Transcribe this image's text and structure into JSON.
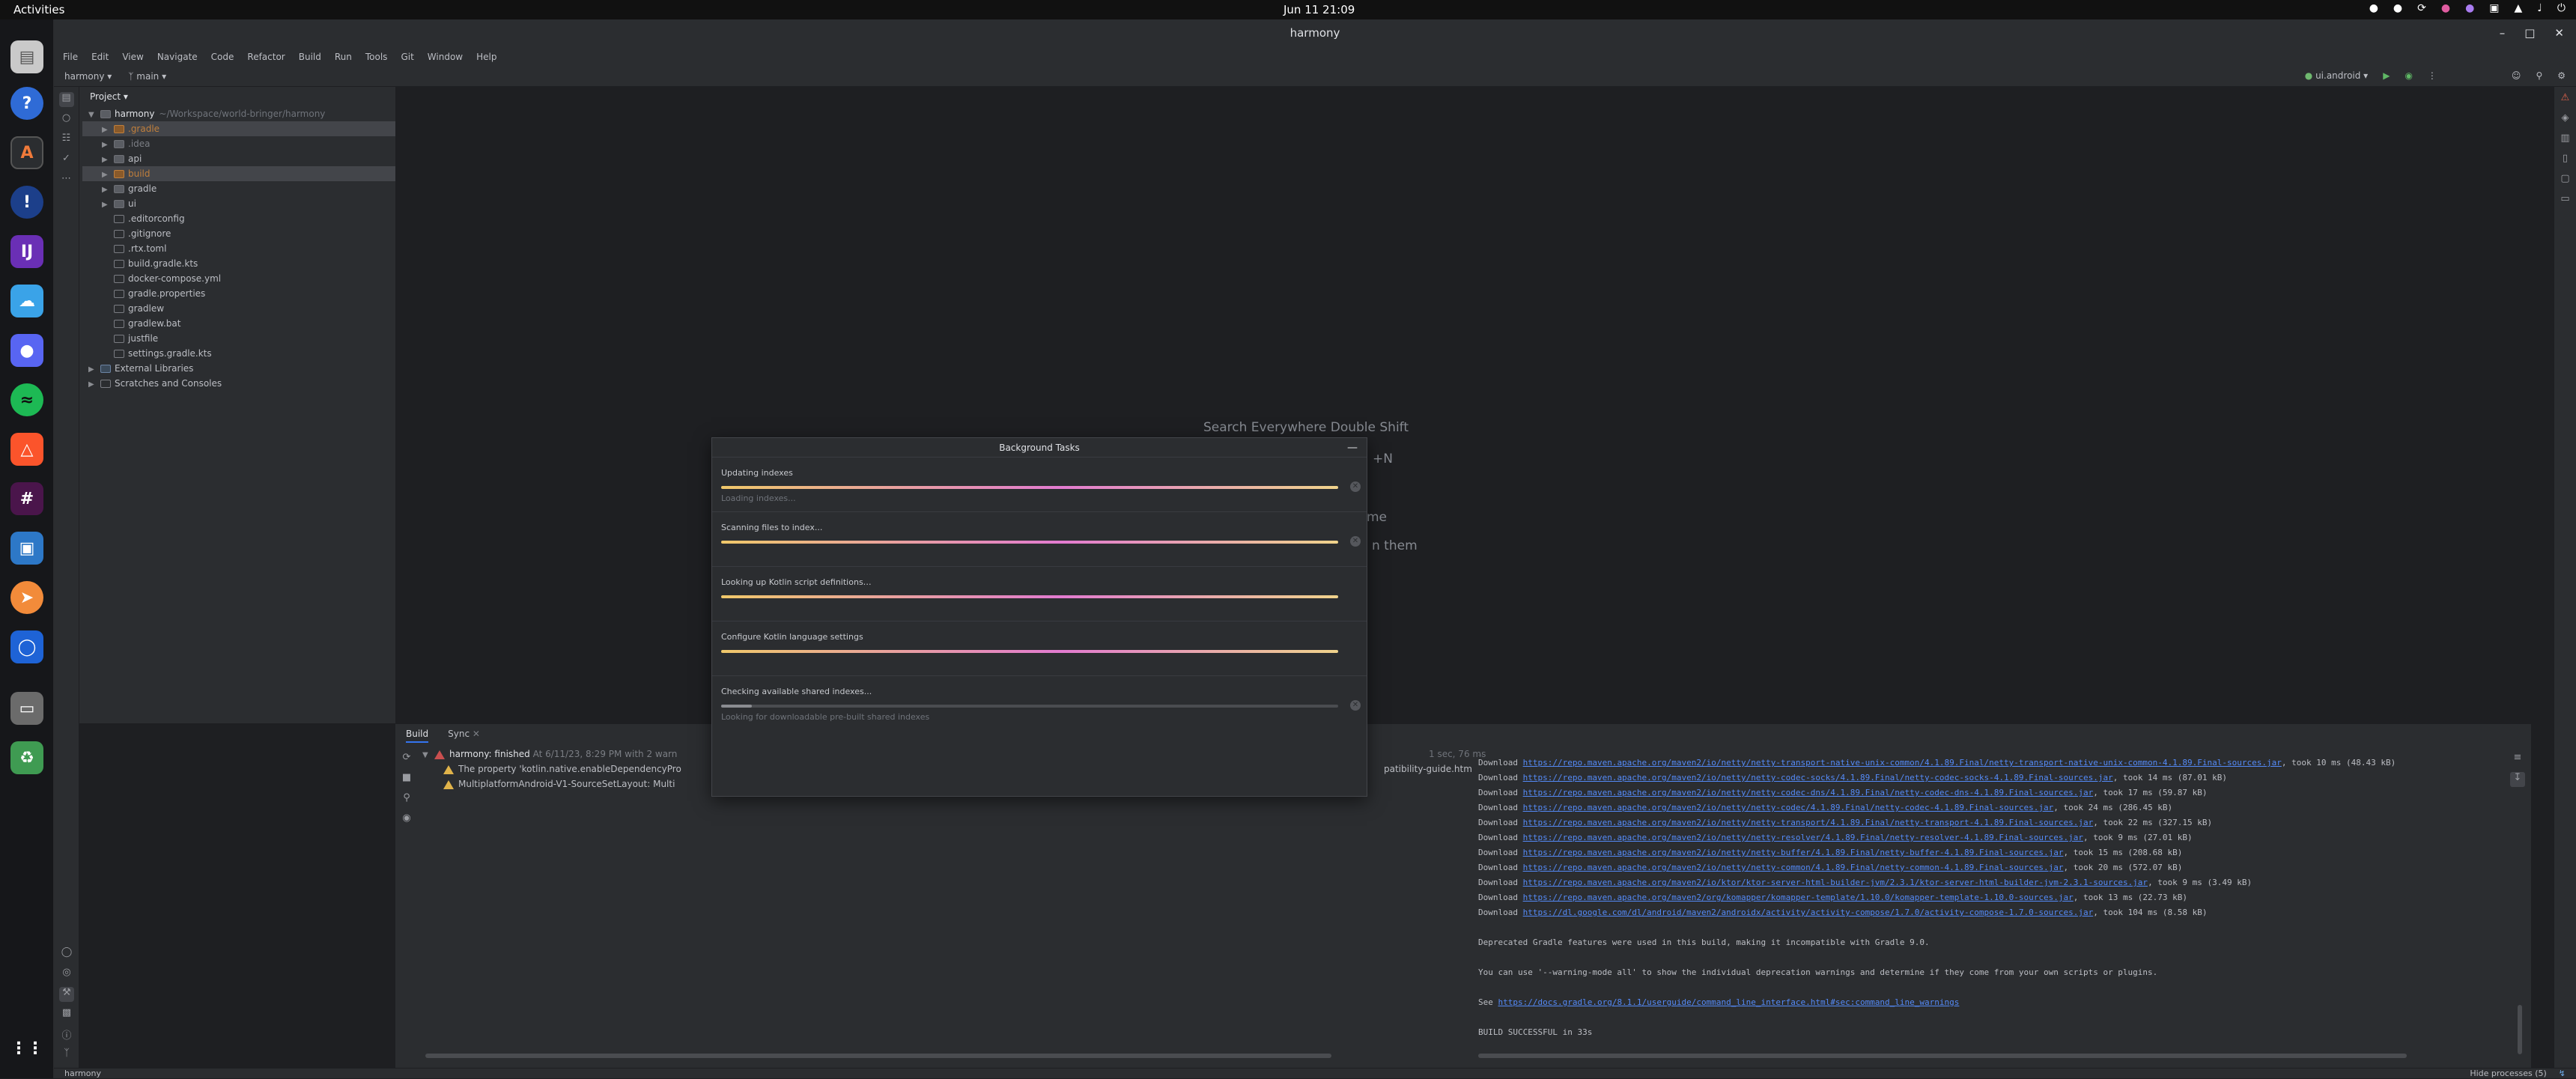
{
  "system": {
    "activities": "Activities",
    "clock": "Jun 11  21:09"
  },
  "window": {
    "title": "harmony"
  },
  "menu": [
    "File",
    "Edit",
    "View",
    "Navigate",
    "Code",
    "Refactor",
    "Build",
    "Run",
    "Tools",
    "Git",
    "Window",
    "Help"
  ],
  "toolbar": {
    "project": "harmony",
    "branch": "main",
    "run_config": "ui.android"
  },
  "project_panel": {
    "title": "Project",
    "root_name": "harmony",
    "root_path": "~/Workspace/world-bringer/harmony",
    "items": [
      {
        "name": ".gradle",
        "type": "excluded"
      },
      {
        "name": ".idea",
        "type": "dir"
      },
      {
        "name": "api",
        "type": "dir"
      },
      {
        "name": "build",
        "type": "excluded"
      },
      {
        "name": "gradle",
        "type": "dir"
      },
      {
        "name": "ui",
        "type": "dir"
      },
      {
        "name": ".editorconfig",
        "type": "file"
      },
      {
        "name": ".gitignore",
        "type": "file"
      },
      {
        "name": ".rtx.toml",
        "type": "file"
      },
      {
        "name": "build.gradle.kts",
        "type": "file"
      },
      {
        "name": "docker-compose.yml",
        "type": "file"
      },
      {
        "name": "gradle.properties",
        "type": "file"
      },
      {
        "name": "gradlew",
        "type": "file"
      },
      {
        "name": "gradlew.bat",
        "type": "file"
      },
      {
        "name": "justfile",
        "type": "file"
      },
      {
        "name": "settings.gradle.kts",
        "type": "file"
      }
    ],
    "external_libraries": "External Libraries",
    "scratches": "Scratches and Consoles"
  },
  "editor_hints": {
    "search": "Search Everywhere  Double Shift",
    "partial1": "+N",
    "partial2": "me",
    "partial3": "n them"
  },
  "background_tasks": {
    "title": "Background Tasks",
    "tasks": [
      {
        "name": "Updating indexes",
        "sub": "Loading indexes..."
      },
      {
        "name": "Scanning files to index...",
        "sub": ""
      },
      {
        "name": "Looking up Kotlin script definitions…",
        "sub": ""
      },
      {
        "name": "Configure Kotlin language settings",
        "sub": ""
      },
      {
        "name": "Checking available shared indexes...",
        "sub": "Looking for downloadable pre-built shared indexes"
      }
    ]
  },
  "build_panel": {
    "tabs": [
      "Build",
      "Sync"
    ],
    "tree": {
      "root": "harmony: finished",
      "root_time": "At 6/11/23, 8:29 PM with 2 warn",
      "root_duration": "1 sec, 76 ms",
      "warn1": "The property 'kotlin.native.enableDependencyPro",
      "warn1_tail": "patibility-guide.htm",
      "warn2": "MultiplatformAndroid-V1-SourceSetLayout: Multi"
    },
    "console": [
      {
        "pre": "Download ",
        "link": "https://repo.maven.apache.org/maven2/io/netty/netty-transport-native-unix-common/4.1.89.Final/netty-transport-native-unix-common-4.1.89.Final-sources.jar",
        "post": ", took 10 ms (48.43 kB)"
      },
      {
        "pre": "Download ",
        "link": "https://repo.maven.apache.org/maven2/io/netty/netty-codec-socks/4.1.89.Final/netty-codec-socks-4.1.89.Final-sources.jar",
        "post": ", took 14 ms (87.01 kB)"
      },
      {
        "pre": "Download ",
        "link": "https://repo.maven.apache.org/maven2/io/netty/netty-codec-dns/4.1.89.Final/netty-codec-dns-4.1.89.Final-sources.jar",
        "post": ", took 17 ms (59.87 kB)"
      },
      {
        "pre": "Download ",
        "link": "https://repo.maven.apache.org/maven2/io/netty/netty-codec/4.1.89.Final/netty-codec-4.1.89.Final-sources.jar",
        "post": ", took 24 ms (286.45 kB)"
      },
      {
        "pre": "Download ",
        "link": "https://repo.maven.apache.org/maven2/io/netty/netty-transport/4.1.89.Final/netty-transport-4.1.89.Final-sources.jar",
        "post": ", took 22 ms (327.15 kB)"
      },
      {
        "pre": "Download ",
        "link": "https://repo.maven.apache.org/maven2/io/netty/netty-resolver/4.1.89.Final/netty-resolver-4.1.89.Final-sources.jar",
        "post": ", took 9 ms (27.01 kB)"
      },
      {
        "pre": "Download ",
        "link": "https://repo.maven.apache.org/maven2/io/netty/netty-buffer/4.1.89.Final/netty-buffer-4.1.89.Final-sources.jar",
        "post": ", took 15 ms (208.68 kB)"
      },
      {
        "pre": "Download ",
        "link": "https://repo.maven.apache.org/maven2/io/netty/netty-common/4.1.89.Final/netty-common-4.1.89.Final-sources.jar",
        "post": ", took 20 ms (572.07 kB)"
      },
      {
        "pre": "Download ",
        "link": "https://repo.maven.apache.org/maven2/io/ktor/ktor-server-html-builder-jvm/2.3.1/ktor-server-html-builder-jvm-2.3.1-sources.jar",
        "post": ", took 9 ms (3.49 kB)"
      },
      {
        "pre": "Download ",
        "link": "https://repo.maven.apache.org/maven2/org/komapper/komapper-template/1.10.0/komapper-template-1.10.0-sources.jar",
        "post": ", took 13 ms (22.73 kB)"
      },
      {
        "pre": "Download ",
        "link": "https://dl.google.com/dl/android/maven2/androidx/activity/activity-compose/1.7.0/activity-compose-1.7.0-sources.jar",
        "post": ", took 104 ms (8.58 kB)"
      }
    ],
    "deprecated": "Deprecated Gradle features were used in this build, making it incompatible with Gradle 9.0.",
    "warning_mode": "You can use '--warning-mode all' to show the individual deprecation warnings and determine if they come from your own scripts or plugins.",
    "see_pre": "See ",
    "see_link": "https://docs.gradle.org/8.1.1/userguide/command_line_interface.html#sec:command_line_warnings",
    "success": "BUILD SUCCESSFUL in 33s"
  },
  "status_bar": {
    "left": "harmony",
    "right": "Hide processes (5)"
  }
}
